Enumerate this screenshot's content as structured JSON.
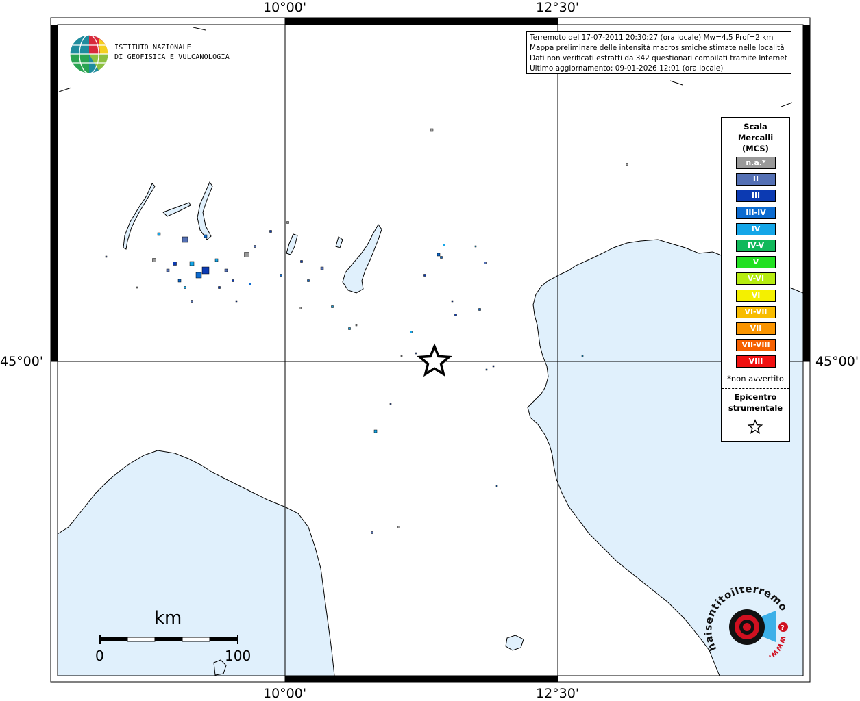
{
  "map": {
    "top_ticks": [
      "10°00'",
      "12°30'"
    ],
    "bottom_ticks": [
      "10°00'",
      "12°30'"
    ],
    "left_tick": "45°00'",
    "right_tick": "45°00'"
  },
  "info": {
    "line1": "Terremoto del 17-07-2011 20:30:27 (ora locale) Mw=4.5 Prof=2 km",
    "line2": "Mappa preliminare delle intensità macrosismiche stimate nelle località",
    "line3": "Dati non verificati estratti da 342 questionari compilati tramite Internet.",
    "line4": "Ultimo aggiornamento: 09-01-2026 12:01 (ora locale)"
  },
  "logo_ingv": {
    "line1": "ISTITUTO NAZIONALE",
    "line2": "DI GEOFISICA E VULCANOLOGIA"
  },
  "legend": {
    "title1": "Scala",
    "title2": "Mercalli",
    "title3": "(MCS)",
    "items": [
      {
        "label": "n.a.*",
        "color": "#999999"
      },
      {
        "label": "II",
        "color": "#5470b4"
      },
      {
        "label": "III",
        "color": "#0c3ab2"
      },
      {
        "label": "III-IV",
        "color": "#0c6bd0"
      },
      {
        "label": "IV",
        "color": "#14a6e8"
      },
      {
        "label": "IV-V",
        "color": "#10b85a"
      },
      {
        "label": "V",
        "color": "#22e022"
      },
      {
        "label": "V-VI",
        "color": "#b6ec10"
      },
      {
        "label": "VI",
        "color": "#f4f000"
      },
      {
        "label": "VI-VII",
        "color": "#f8bc00"
      },
      {
        "label": "VII",
        "color": "#fa9400"
      },
      {
        "label": "VII-VIII",
        "color": "#f66000"
      },
      {
        "label": "VIII",
        "color": "#f01010"
      }
    ],
    "note": "*non avvertito",
    "epicenter1": "Epicentro",
    "epicenter2": "strumentale"
  },
  "scale_bar": {
    "unit": "km",
    "min": "0",
    "max": "100"
  },
  "logo_hsit": {
    "text": "haisentitoilterremoto.it",
    "www": "www."
  },
  "colors": {
    "sea": "#e0f0fc",
    "frame": "#000000"
  }
}
